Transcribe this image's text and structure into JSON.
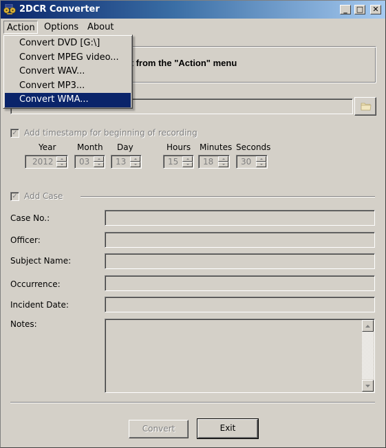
{
  "window": {
    "title": "2DCR Converter",
    "icon": "reel-to-reel-tape-icon",
    "controls": [
      "minimize",
      "maximize",
      "close"
    ],
    "controls_glyphs": {
      "minimize": "_",
      "maximize": "□",
      "close": "✕"
    }
  },
  "menubar": {
    "items": [
      {
        "label": "Action",
        "open": true
      },
      {
        "label": "Options"
      },
      {
        "label": "About"
      }
    ]
  },
  "action_menu": {
    "items": [
      {
        "label": "Convert DVD [G:\\]"
      },
      {
        "label": "Convert MPEG video..."
      },
      {
        "label": "Convert WAV..."
      },
      {
        "label": "Convert MP3..."
      },
      {
        "label": "Convert WMA...",
        "highlighted": true
      }
    ]
  },
  "instruction": {
    "text": "nvert from the \"Action\" menu",
    "full_text_hidden_by_menu": "Select what to convert from the \"Action\" menu"
  },
  "file_path": {
    "value": "",
    "browse_icon": "folder-icon"
  },
  "timestamp": {
    "checkbox_label": "Add timestamp for beginning of recording",
    "checked": true,
    "enabled": false,
    "fields": [
      {
        "label": "Year",
        "value": "2012"
      },
      {
        "label": "Month",
        "value": "03"
      },
      {
        "label": "Day",
        "value": "13"
      },
      {
        "label": "Hours",
        "value": "15"
      },
      {
        "label": "Minutes",
        "value": "18"
      },
      {
        "label": "Seconds",
        "value": "30"
      }
    ]
  },
  "case": {
    "checkbox_label": "Add Case",
    "checked": true,
    "enabled": false,
    "fields": [
      {
        "label": "Case No.:",
        "value": ""
      },
      {
        "label": "Officer:",
        "value": ""
      },
      {
        "label": "Subject Name:",
        "value": ""
      },
      {
        "label": "Occurrence:",
        "value": ""
      },
      {
        "label": "Incident Date:",
        "value": ""
      }
    ],
    "notes": {
      "label": "Notes:",
      "value": ""
    }
  },
  "buttons": {
    "convert": {
      "label": "Convert",
      "enabled": false
    },
    "exit": {
      "label": "Exit",
      "enabled": true,
      "default": true
    }
  },
  "colors": {
    "face": "#d4d0c8",
    "title_gradient_start": "#0a246a",
    "title_gradient_end": "#a6caf0",
    "selection": "#0a246a",
    "disabled_text": "#808080"
  }
}
